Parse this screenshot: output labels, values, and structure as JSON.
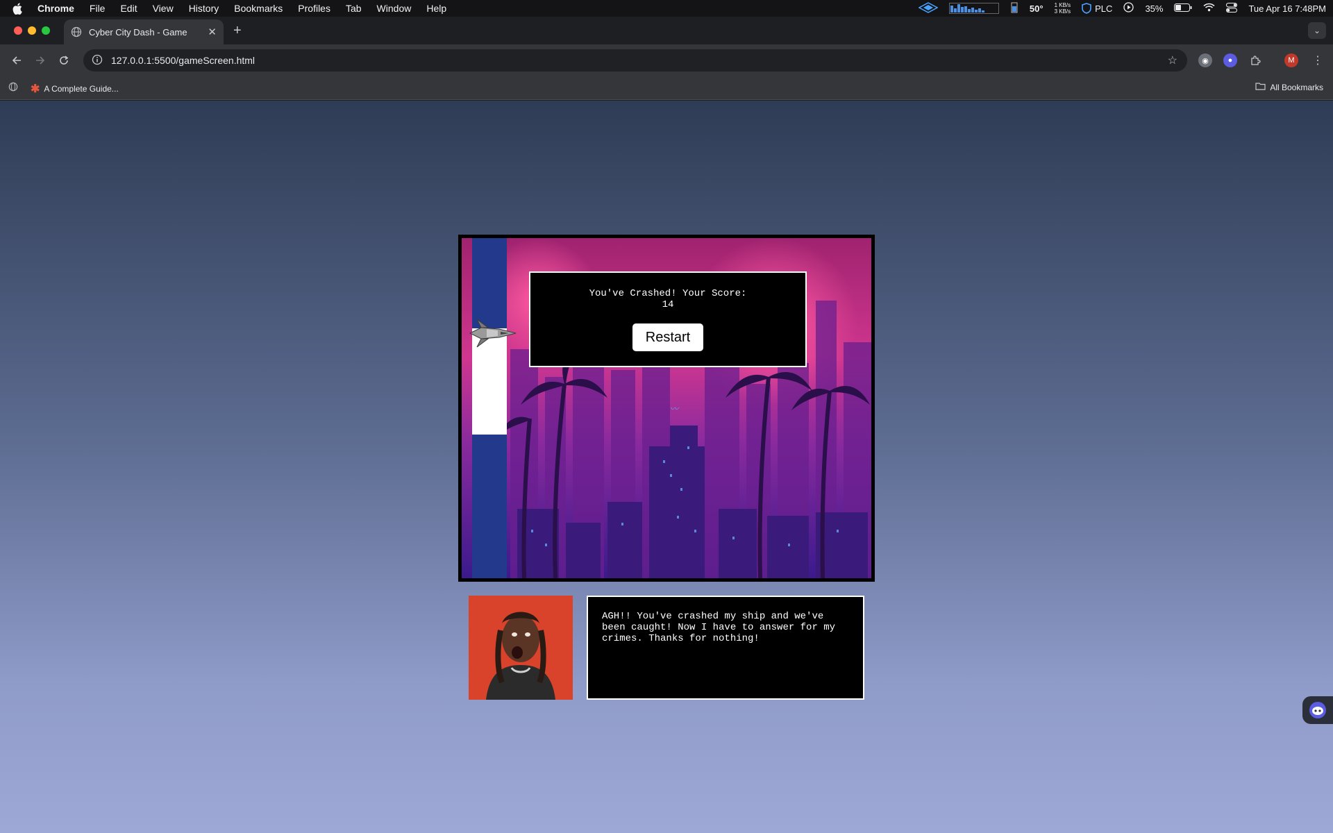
{
  "menubar": {
    "app_name": "Chrome",
    "items": [
      "File",
      "Edit",
      "View",
      "History",
      "Bookmarks",
      "Profiles",
      "Tab",
      "Window",
      "Help"
    ],
    "temperature": "50°",
    "network_up": "1 KB/s",
    "network_down": "3 KB/s",
    "vpn_label": "PLC",
    "battery": "35%",
    "datetime": "Tue Apr 16  7:48PM"
  },
  "browser": {
    "tab_title": "Cyber City Dash - Game",
    "url": "127.0.0.1:5500/gameScreen.html",
    "bookmark_item": "A Complete Guide...",
    "all_bookmarks": "All Bookmarks",
    "profile_initial": "M"
  },
  "game": {
    "crash_message": "You've Crashed! Your Score:",
    "score": "14",
    "restart_label": "Restart"
  },
  "dialogue": {
    "text": "AGH!! You've crashed my ship and we've been caught! Now I have to answer for my crimes. Thanks for nothing!"
  },
  "colors": {
    "pipe": "#23398c",
    "page_gradient_top": "#2e3c55",
    "page_gradient_bottom": "#9ea8d6",
    "portrait_bg": "#e2482f"
  }
}
